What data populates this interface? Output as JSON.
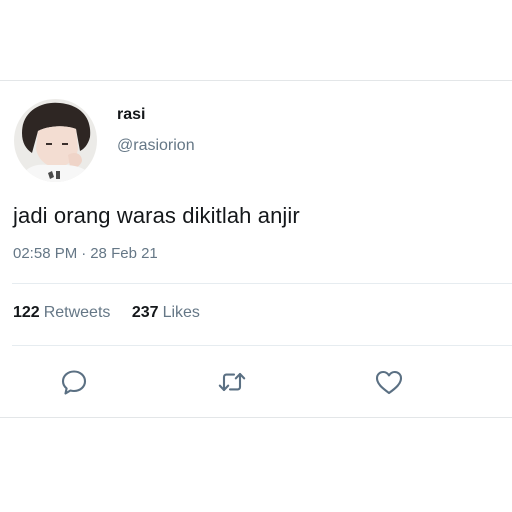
{
  "tweet": {
    "author": {
      "display_name": "rasi",
      "handle": "@rasiorion"
    },
    "text": "jadi orang waras dikitlah anjir",
    "time": "02:58 PM",
    "separator": "·",
    "date": "28 Feb 21",
    "stats": {
      "retweets_count": "122",
      "retweets_label": "Retweets",
      "likes_count": "237",
      "likes_label": "Likes"
    },
    "actions": [
      {
        "icon": "reply-icon"
      },
      {
        "icon": "retweet-icon"
      },
      {
        "icon": "like-icon"
      }
    ]
  },
  "colors": {
    "text_primary": "#14171a",
    "text_secondary": "#657786",
    "divider": "#e6ecf0"
  }
}
